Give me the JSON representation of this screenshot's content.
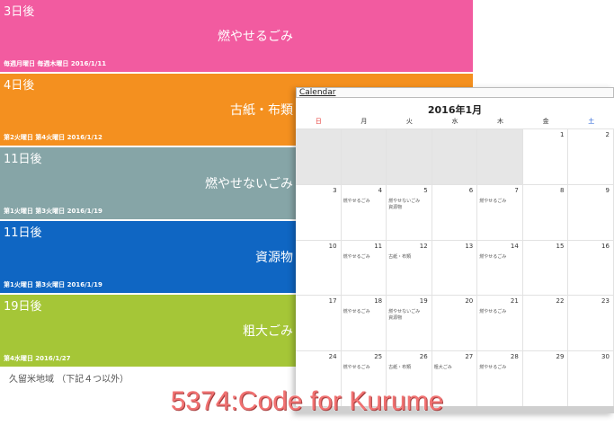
{
  "garbage_list": {
    "items": [
      {
        "days": "3日後",
        "name": "燃やせるごみ",
        "schedule": "毎週月曜日 毎週木曜日 2016/1/11",
        "color": "#f25ba0"
      },
      {
        "days": "4日後",
        "name": "古紙・布類",
        "schedule": "第2火曜日 第4火曜日 2016/1/12",
        "color": "#f4901f"
      },
      {
        "days": "11日後",
        "name": "燃やせないごみ",
        "schedule": "第1火曜日 第3火曜日 2016/1/19",
        "color": "#86a5a7"
      },
      {
        "days": "11日後",
        "name": "資源物",
        "schedule": "第1火曜日 第3火曜日 2016/1/19",
        "color": "#0f66c3"
      },
      {
        "days": "19日後",
        "name": "粗大ごみ",
        "schedule": "第4水曜日 2016/1/27",
        "color": "#a5c637"
      }
    ],
    "footer": "久留米地域 （下記４つ以外）"
  },
  "calendar": {
    "header_label": "Calendar",
    "title": "2016年1月",
    "weekdays": [
      "日",
      "月",
      "火",
      "水",
      "木",
      "金",
      "土"
    ],
    "weeks": [
      [
        {
          "day": "",
          "empty": true
        },
        {
          "day": "",
          "empty": true
        },
        {
          "day": "",
          "empty": true
        },
        {
          "day": "",
          "empty": true
        },
        {
          "day": "",
          "empty": true
        },
        {
          "day": "1",
          "events": []
        },
        {
          "day": "2",
          "events": []
        }
      ],
      [
        {
          "day": "3",
          "events": []
        },
        {
          "day": "4",
          "events": [
            "燃やせるごみ"
          ]
        },
        {
          "day": "5",
          "events": [
            "燃やせないごみ",
            "資源物"
          ]
        },
        {
          "day": "6",
          "events": []
        },
        {
          "day": "7",
          "events": [
            "燃やせるごみ"
          ]
        },
        {
          "day": "8",
          "events": []
        },
        {
          "day": "9",
          "events": []
        }
      ],
      [
        {
          "day": "10",
          "events": []
        },
        {
          "day": "11",
          "events": [
            "燃やせるごみ"
          ]
        },
        {
          "day": "12",
          "events": [
            "古紙・布類"
          ]
        },
        {
          "day": "13",
          "events": []
        },
        {
          "day": "14",
          "events": [
            "燃やせるごみ"
          ]
        },
        {
          "day": "15",
          "events": []
        },
        {
          "day": "16",
          "events": []
        }
      ],
      [
        {
          "day": "17",
          "events": []
        },
        {
          "day": "18",
          "events": [
            "燃やせるごみ"
          ]
        },
        {
          "day": "19",
          "events": [
            "燃やせないごみ",
            "資源物"
          ]
        },
        {
          "day": "20",
          "events": []
        },
        {
          "day": "21",
          "events": [
            "燃やせるごみ"
          ]
        },
        {
          "day": "22",
          "events": []
        },
        {
          "day": "23",
          "events": []
        }
      ],
      [
        {
          "day": "24",
          "events": []
        },
        {
          "day": "25",
          "events": [
            "燃やせるごみ"
          ]
        },
        {
          "day": "26",
          "events": [
            "古紙・布類"
          ]
        },
        {
          "day": "27",
          "events": [
            "粗大ごみ"
          ]
        },
        {
          "day": "28",
          "events": [
            "燃やせるごみ"
          ]
        },
        {
          "day": "29",
          "events": []
        },
        {
          "day": "30",
          "events": []
        }
      ]
    ]
  },
  "banner": {
    "text": "5374:Code for Kurume"
  }
}
